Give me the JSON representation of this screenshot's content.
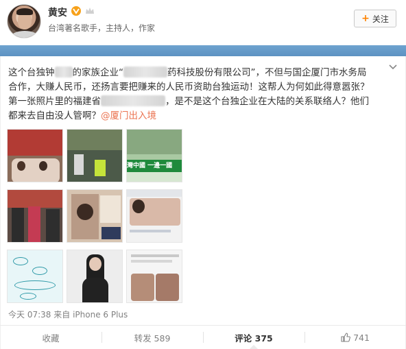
{
  "user": {
    "name": "黄安",
    "verified_badge": "V",
    "description": "台湾著名歌手，主持人，作家",
    "follow_label": "关注"
  },
  "post": {
    "line1_pre": "这个台独钟",
    "line1_mid": "的家族企业“",
    "line1_post": "药科技股份有限公司”，不但与国企厦门市水务局",
    "line2": "合作，大赚人民币，还扬言要把赚来的人民币资助台独运动！这帮人为何如此得意嚣张？",
    "line3_pre": "第一张照片里的福建省",
    "line3_post": "，是不是这个台独企业在大陆的关系联络人？他们",
    "line4_pre": "都来去自由没人管啊？",
    "mention": "@厦门出入境",
    "photo_banner_text": "灣中國 一邊一國"
  },
  "meta": {
    "time": "今天 07:38",
    "source_prefix": "来自",
    "source": "iPhone 6 Plus"
  },
  "actions": {
    "favorite": "收藏",
    "repost": "转发 589",
    "comment": "评论 375",
    "like": "741"
  },
  "colors": {
    "accent_orange": "#ff8200",
    "mention": "#eb7350",
    "banner_blue": "#5d92c2"
  }
}
